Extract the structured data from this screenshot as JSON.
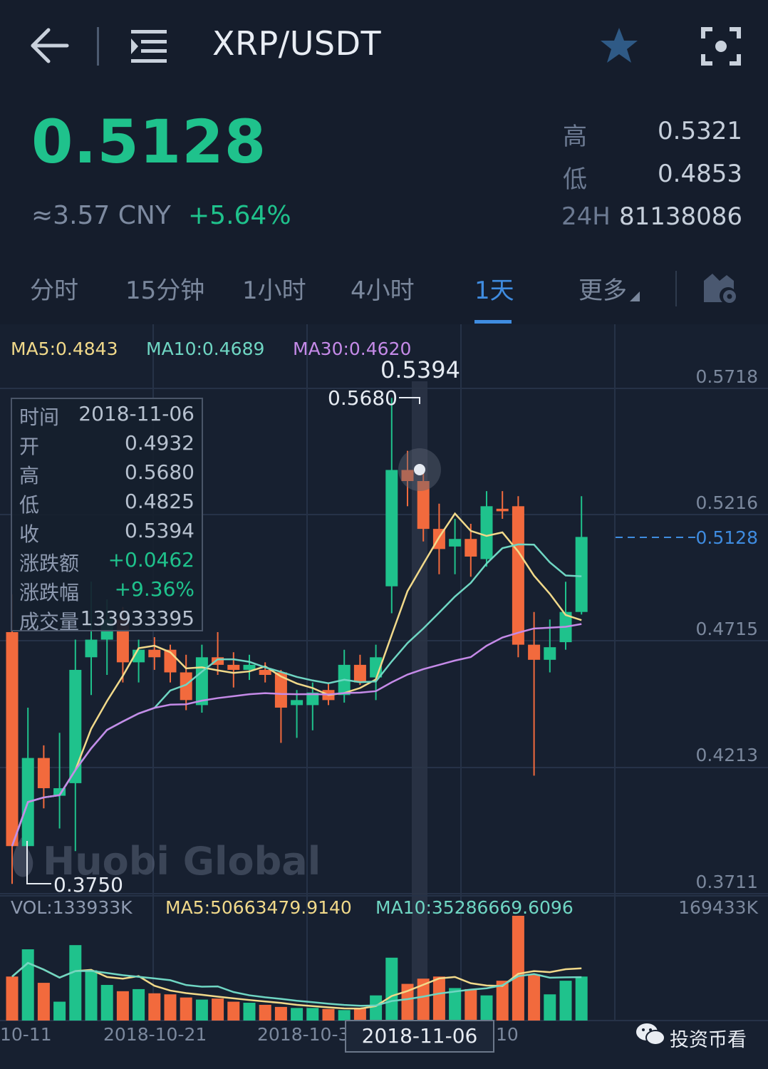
{
  "header": {
    "pair": "XRP/USDT"
  },
  "ticker": {
    "price": "0.5128",
    "cny": "≈3.57 CNY",
    "change": "+5.64%",
    "high_label": "高",
    "high_value": "0.5321",
    "low_label": "低",
    "low_value": "0.4853",
    "vol_label": "24H",
    "vol_value": "81138086"
  },
  "tabs": [
    {
      "label": "分时",
      "active": false
    },
    {
      "label": "15分钟",
      "active": false
    },
    {
      "label": "1小时",
      "active": false
    },
    {
      "label": "4小时",
      "active": false
    },
    {
      "label": "1天",
      "active": true
    },
    {
      "label": "更多",
      "active": false
    }
  ],
  "icons": {
    "back": "arrow-left-icon",
    "menu": "menu-list-icon",
    "favorite": "star-icon",
    "fullscreen": "fullscreen-icon",
    "settings": "chart-settings-icon"
  },
  "colors": {
    "up": "#1fc28c",
    "down": "#f26a3d",
    "accent": "#3f8ce0",
    "ma5": "#f1d98a",
    "ma10": "#6fd6c3",
    "ma30": "#c58ae8"
  },
  "indicators": {
    "ma5": "MA5:0.4843",
    "ma10": "MA10:0.4689",
    "ma30": "MA30:0.4620"
  },
  "selected": {
    "close_label": "0.5394",
    "high_label": "0.5680",
    "date": "2018-11-06",
    "rows": [
      {
        "k": "时间",
        "v": "2018-11-06",
        "green": false
      },
      {
        "k": "开",
        "v": "0.4932",
        "green": false
      },
      {
        "k": "高",
        "v": "0.5680",
        "green": false
      },
      {
        "k": "低",
        "v": "0.4825",
        "green": false
      },
      {
        "k": "收",
        "v": "0.5394",
        "green": false
      },
      {
        "k": "涨跌额",
        "v": "+0.0462",
        "green": true
      },
      {
        "k": "涨跌幅",
        "v": "+9.36%",
        "green": true
      },
      {
        "k": "成交量",
        "v": "133933395",
        "green": false
      }
    ]
  },
  "price_axis": [
    "0.5718",
    "0.5216",
    "0.4715",
    "0.4213",
    "0.3711"
  ],
  "current_price_label": "0.5128",
  "min_label": "0.3750",
  "volume": {
    "vol": "VOL:133933K",
    "ma5": "MA5:50663479.9140",
    "ma10": "MA10:35286669.6096",
    "axis_max": "169433K"
  },
  "date_axis": [
    "10-11",
    "2018-10-21",
    "2018-10-3",
    "10"
  ],
  "watermark": "Huobi Global",
  "source_badge": "投资币看",
  "chart_data": {
    "type": "candlestick",
    "ylim": [
      0.3711,
      0.5718
    ],
    "candles": [
      {
        "o": 0.475,
        "h": 0.49,
        "l": 0.375,
        "c": 0.39
      },
      {
        "o": 0.39,
        "h": 0.445,
        "l": 0.39,
        "c": 0.425
      },
      {
        "o": 0.425,
        "h": 0.43,
        "l": 0.405,
        "c": 0.413
      },
      {
        "o": 0.41,
        "h": 0.435,
        "l": 0.397,
        "c": 0.413
      },
      {
        "o": 0.415,
        "h": 0.472,
        "l": 0.388,
        "c": 0.46
      },
      {
        "o": 0.465,
        "h": 0.495,
        "l": 0.45,
        "c": 0.472
      },
      {
        "o": 0.472,
        "h": 0.488,
        "l": 0.458,
        "c": 0.48
      },
      {
        "o": 0.48,
        "h": 0.485,
        "l": 0.455,
        "c": 0.463
      },
      {
        "o": 0.463,
        "h": 0.472,
        "l": 0.455,
        "c": 0.468
      },
      {
        "o": 0.468,
        "h": 0.473,
        "l": 0.46,
        "c": 0.465
      },
      {
        "o": 0.468,
        "h": 0.47,
        "l": 0.455,
        "c": 0.459
      },
      {
        "o": 0.459,
        "h": 0.466,
        "l": 0.444,
        "c": 0.448
      },
      {
        "o": 0.446,
        "h": 0.47,
        "l": 0.443,
        "c": 0.465
      },
      {
        "o": 0.465,
        "h": 0.475,
        "l": 0.458,
        "c": 0.462
      },
      {
        "o": 0.462,
        "h": 0.467,
        "l": 0.453,
        "c": 0.46
      },
      {
        "o": 0.46,
        "h": 0.466,
        "l": 0.456,
        "c": 0.462
      },
      {
        "o": 0.46,
        "h": 0.463,
        "l": 0.455,
        "c": 0.458
      },
      {
        "o": 0.459,
        "h": 0.46,
        "l": 0.431,
        "c": 0.445
      },
      {
        "o": 0.446,
        "h": 0.452,
        "l": 0.433,
        "c": 0.448
      },
      {
        "o": 0.446,
        "h": 0.455,
        "l": 0.436,
        "c": 0.451
      },
      {
        "o": 0.452,
        "h": 0.455,
        "l": 0.446,
        "c": 0.448
      },
      {
        "o": 0.45,
        "h": 0.468,
        "l": 0.447,
        "c": 0.462
      },
      {
        "o": 0.462,
        "h": 0.466,
        "l": 0.454,
        "c": 0.455
      },
      {
        "o": 0.457,
        "h": 0.47,
        "l": 0.448,
        "c": 0.465
      },
      {
        "o": 0.4932,
        "h": 0.568,
        "l": 0.4825,
        "c": 0.5394
      },
      {
        "o": 0.5394,
        "h": 0.547,
        "l": 0.525,
        "c": 0.535
      },
      {
        "o": 0.535,
        "h": 0.54,
        "l": 0.511,
        "c": 0.516
      },
      {
        "o": 0.516,
        "h": 0.526,
        "l": 0.498,
        "c": 0.508
      },
      {
        "o": 0.509,
        "h": 0.52,
        "l": 0.498,
        "c": 0.512
      },
      {
        "o": 0.512,
        "h": 0.518,
        "l": 0.497,
        "c": 0.505
      },
      {
        "o": 0.504,
        "h": 0.531,
        "l": 0.501,
        "c": 0.525
      },
      {
        "o": 0.524,
        "h": 0.531,
        "l": 0.52,
        "c": 0.523
      },
      {
        "o": 0.525,
        "h": 0.529,
        "l": 0.465,
        "c": 0.47
      },
      {
        "o": 0.47,
        "h": 0.483,
        "l": 0.418,
        "c": 0.464
      },
      {
        "o": 0.464,
        "h": 0.48,
        "l": 0.459,
        "c": 0.469
      },
      {
        "o": 0.471,
        "h": 0.495,
        "l": 0.468,
        "c": 0.483
      },
      {
        "o": 0.483,
        "h": 0.529,
        "l": 0.482,
        "c": 0.5128
      }
    ],
    "volume_relative": [
      0.42,
      0.68,
      0.36,
      0.18,
      0.72,
      0.48,
      0.34,
      0.28,
      0.3,
      0.26,
      0.25,
      0.22,
      0.2,
      0.21,
      0.18,
      0.17,
      0.15,
      0.13,
      0.12,
      0.12,
      0.11,
      0.1,
      0.12,
      0.24,
      0.6,
      0.35,
      0.4,
      0.42,
      0.31,
      0.3,
      0.24,
      0.38,
      1.0,
      0.44,
      0.25,
      0.38,
      0.42
    ]
  }
}
